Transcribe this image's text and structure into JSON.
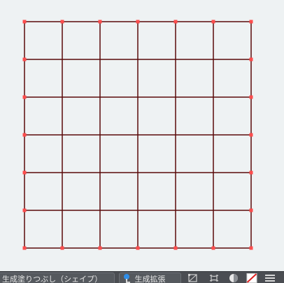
{
  "canvas": {
    "background": "#eef2f3",
    "grid_line_color": "#5a0a0a",
    "anchor_color": "#ff4d4d",
    "rows": 6,
    "columns": 6
  },
  "bottom_bar": {
    "background": "#4a4d52",
    "shape_fill_label": "生成塗りつぶし（シェイプ）",
    "generative_expand_label": "生成拡張",
    "icons": [
      "expand-icon",
      "transform-icon",
      "warp-icon",
      "circle-icon",
      "swatch-icon",
      "menu-icon"
    ]
  }
}
